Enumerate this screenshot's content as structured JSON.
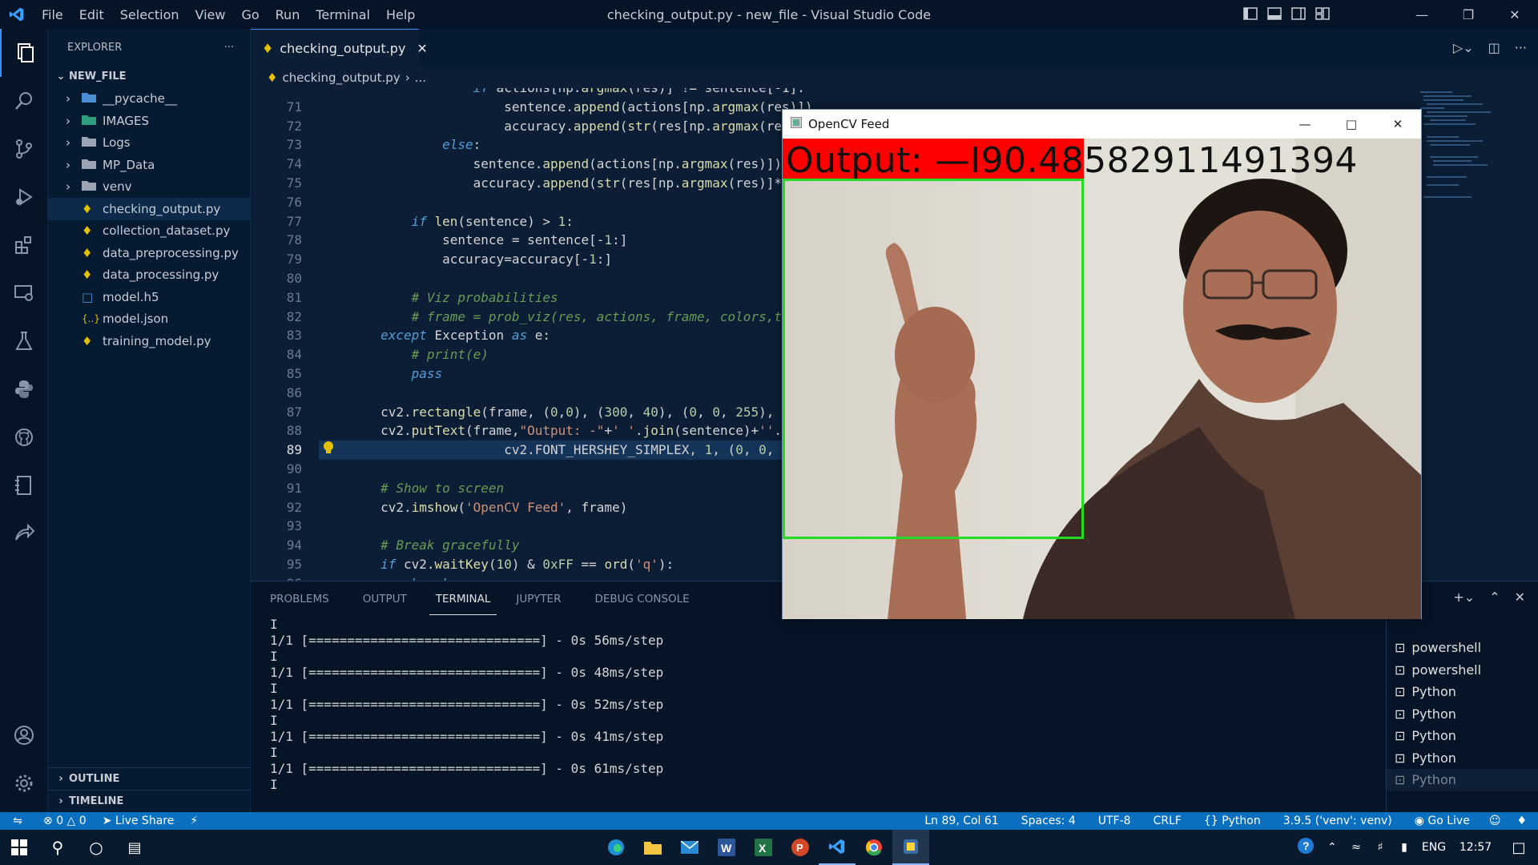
{
  "window": {
    "title": "checking_output.py - new_file - Visual Studio Code",
    "menu": [
      "File",
      "Edit",
      "Selection",
      "View",
      "Go",
      "Run",
      "Terminal",
      "Help"
    ]
  },
  "sidebar": {
    "header": "EXPLORER",
    "root": "NEW_FILE",
    "folders": [
      "__pycache__",
      "IMAGES",
      "Logs",
      "MP_Data",
      "venv"
    ],
    "files": [
      "checking_output.py",
      "collection_dataset.py",
      "data_preprocessing.py",
      "data_processing.py",
      "model.h5",
      "model.json",
      "training_model.py"
    ],
    "outline": "OUTLINE",
    "timeline": "TIMELINE"
  },
  "editor": {
    "tab": "checking_output.py",
    "breadcrumb_file": "checking_output.py",
    "breadcrumb_more": "...",
    "line_numbers": [
      "71",
      "72",
      "73",
      "74",
      "75",
      "76",
      "77",
      "78",
      "79",
      "80",
      "81",
      "82",
      "83",
      "84",
      "85",
      "86",
      "87",
      "88",
      "89",
      "90",
      "91",
      "92",
      "93",
      "94",
      "95",
      "96"
    ],
    "current_line": "89"
  },
  "panel": {
    "tabs": [
      "PROBLEMS",
      "OUTPUT",
      "TERMINAL",
      "JUPYTER",
      "DEBUG CONSOLE"
    ],
    "active_tab": "TERMINAL",
    "terminal_lines": [
      "I",
      "1/1 [==============================] - 0s 56ms/step",
      "I",
      "1/1 [==============================] - 0s 48ms/step",
      "I",
      "1/1 [==============================] - 0s 52ms/step",
      "I",
      "1/1 [==============================] - 0s 41ms/step",
      "I",
      "1/1 [==============================] - 0s 61ms/step",
      "I"
    ],
    "terminals": [
      "powershell",
      "powershell",
      "Python",
      "Python",
      "Python",
      "Python",
      "Python"
    ]
  },
  "statusbar": {
    "errors": "0",
    "warnings": "0",
    "live_share": "Live Share",
    "position": "Ln 89, Col 61",
    "spaces": "Spaces: 4",
    "encoding": "UTF-8",
    "eol": "CRLF",
    "language": "Python",
    "interpreter": "3.9.5 ('venv': venv)",
    "go_live": "Go Live"
  },
  "cv_window": {
    "title": "OpenCV Feed",
    "output_text": "Output: —I90.48582911491394"
  },
  "taskbar": {
    "lang": "ENG",
    "time": "12:57"
  },
  "colors": {
    "accent": "#3794ff",
    "status": "#0a6fbf",
    "cv_bar": "#ff0000",
    "cv_box": "#22dd22"
  }
}
